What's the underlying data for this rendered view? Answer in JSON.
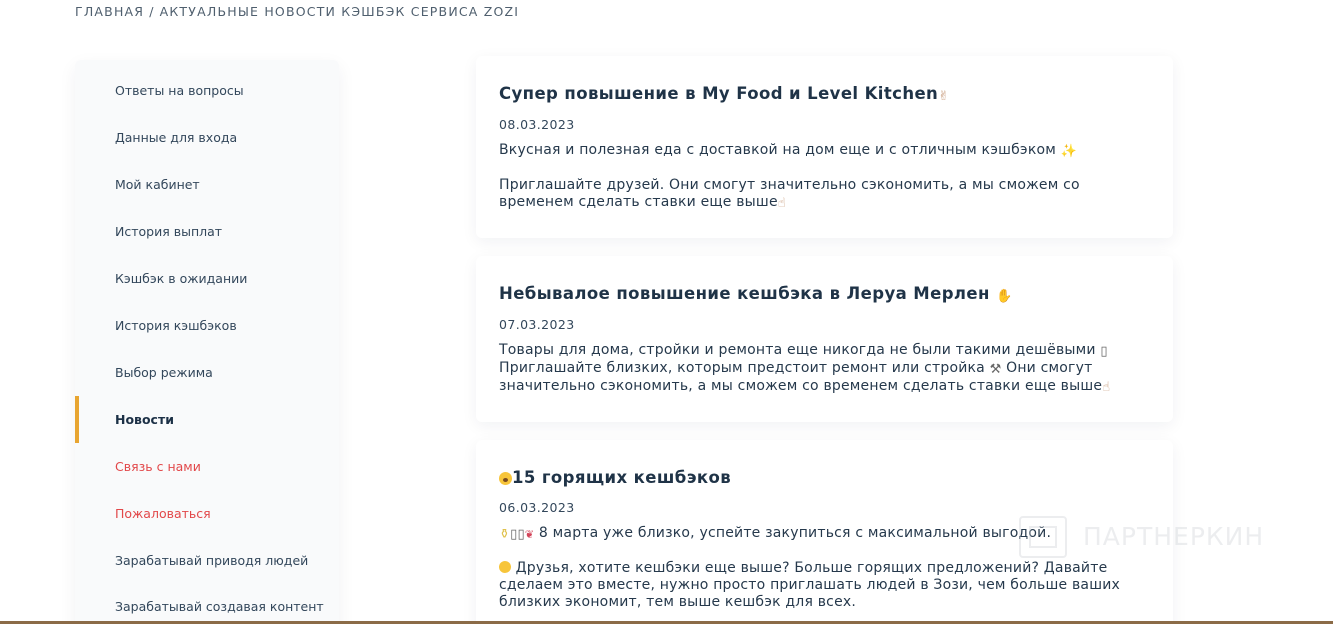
{
  "breadcrumb": {
    "home": "Главная",
    "separator": "/",
    "current": "Актуальные новости кэшбэк сервиса Zozi"
  },
  "sidebar": {
    "items": [
      {
        "label": "Ответы на вопросы"
      },
      {
        "label": "Данные для входа"
      },
      {
        "label": "Мой кабинет"
      },
      {
        "label": "История выплат"
      },
      {
        "label": "Кэшбэк в ожидании"
      },
      {
        "label": "История кэшбэков"
      },
      {
        "label": "Выбор режима"
      },
      {
        "label": "Новости"
      },
      {
        "label": "Связь с нами"
      },
      {
        "label": "Пожаловаться"
      },
      {
        "label": "Зарабатывай приводя людей"
      },
      {
        "label": "Зарабатывай создавая контент"
      }
    ],
    "active_item": "Новости",
    "accent_color": "#e8a531",
    "highlight_color": "#e2484a"
  },
  "news": [
    {
      "title": "Супер повышение в My Food и Level Kitchen",
      "title_icon": "victory-hand-icon",
      "date": "08.03.2023",
      "p1": "Вкусная и полезная еда с доставкой на дом еще и с отличным кэшбэком",
      "p1_icon": "sparkles-icon",
      "p2": "Приглашайте друзей. Они смогут значительно сэкономить, а мы сможем со временем сделать ставки еще выше",
      "p2_icon": "pointing-hand-icon"
    },
    {
      "title": "Небывалое повышение кешбэка в Леруа Мерлен",
      "title_icon": "fire-icon",
      "date": "07.03.2023",
      "p1": "Товары для дома, стройки и ремонта еще никогда не были такими дешёвыми",
      "p1_icon": "house-icon",
      "p1b": "Приглашайте близких, которым предстоит ремонт или стройка",
      "p1b_icon": "hammer-icon",
      "p1c": "Они смогут значительно сэкономить, а мы сможем со временем сделать ставки еще выше",
      "p1c_icon": "pointing-hand-icon"
    },
    {
      "title": "15 горящих кешбэков",
      "title_icon": "astonished-face-icon",
      "date": "06.03.2023",
      "p1": "8 марта уже близко, успейте закупиться с максимальной выгодой.",
      "p1_icon": "perfume-flowers-icon",
      "p2": "Друзья, хотите кешбэки еще выше? Больше горящих предложений? Давайте сделаем это вместе, нужно просто приглашать людей в Зози, чем больше ваших близких экономит, тем выше кешбэк для всех.",
      "p2_icon": "winking-face-icon"
    }
  ],
  "watermark": {
    "text": "ПАРТНЕРКИН"
  }
}
